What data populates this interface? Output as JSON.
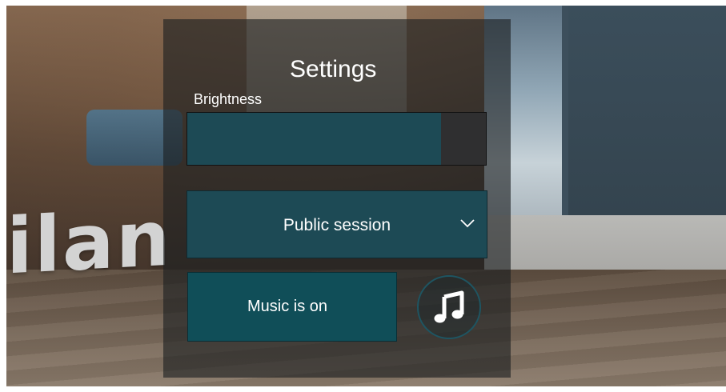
{
  "scene": {
    "wordmark": "ilan"
  },
  "settings": {
    "title": "Settings",
    "brightness": {
      "label": "Brightness",
      "value": 0.85
    },
    "session": {
      "selected": "Public session"
    },
    "music": {
      "button_label": "Music is on",
      "icon": "music-note-icon"
    }
  },
  "colors": {
    "panel_accent": "#1d4a55",
    "music_button": "#104e58",
    "text": "#ffffff"
  }
}
